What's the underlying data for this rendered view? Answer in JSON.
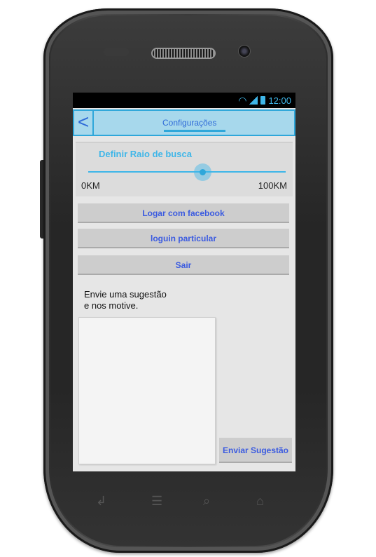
{
  "status_bar": {
    "time": "12:00"
  },
  "action_bar": {
    "back_label": "<",
    "tab_label": "Configurações"
  },
  "slider": {
    "title": "Definir Raio de busca",
    "min_label": "0KM",
    "max_label": "100KM",
    "value_fraction": 0.58
  },
  "buttons": {
    "facebook_label": "Logar com facebook",
    "login_label": "loguin particular",
    "exit_label": "Sair",
    "send_label": "Enviar Sugestão"
  },
  "suggestion": {
    "line1": "Envie uma sugestão",
    "line2": "e nos motive.",
    "value": ""
  },
  "colors": {
    "accent": "#3fb6e8",
    "action_bar": "#a7d8ec",
    "button_text": "#3b5be0"
  },
  "icons": [
    "wifi-icon",
    "signal-icon",
    "battery-icon",
    "back-nav-icon",
    "home-nav-icon",
    "menu-nav-icon",
    "search-nav-icon"
  ]
}
